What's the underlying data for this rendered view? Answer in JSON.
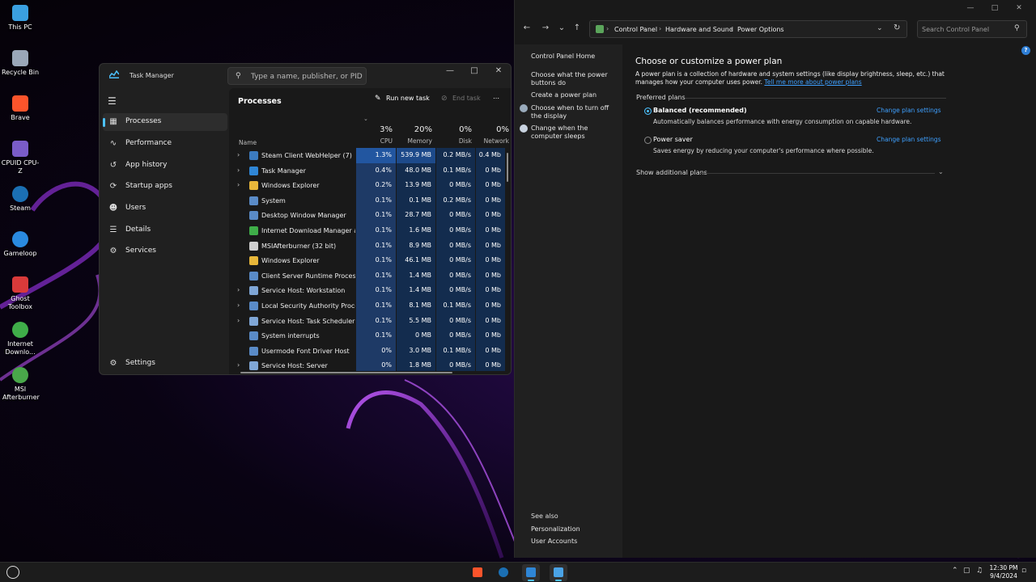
{
  "desktop": {
    "icons": [
      {
        "label": "This PC",
        "color": "#3aa0e0"
      },
      {
        "label": "Recycle Bin",
        "color": "#9aa8b8"
      },
      {
        "label": "Brave",
        "color": "#fb542b"
      },
      {
        "label": "CPUID CPU-Z",
        "color": "#7a5cc8"
      },
      {
        "label": "Steam",
        "color": "#1b6fb3"
      },
      {
        "label": "Gameloop",
        "color": "#2a8ae0"
      },
      {
        "label": "Ghost Toolbox",
        "color": "#d93a3a"
      },
      {
        "label": "Internet Downlo...",
        "color": "#3fae49"
      },
      {
        "label": "MSI Afterburner",
        "color": "#49a84a"
      }
    ]
  },
  "task_manager": {
    "title": "Task Manager",
    "search_placeholder": "Type a name, publisher, or PID...",
    "nav": [
      {
        "label": "Processes",
        "icon": "processes-icon",
        "active": true
      },
      {
        "label": "Performance",
        "icon": "performance-icon"
      },
      {
        "label": "App history",
        "icon": "history-icon"
      },
      {
        "label": "Startup apps",
        "icon": "startup-icon"
      },
      {
        "label": "Users",
        "icon": "users-icon"
      },
      {
        "label": "Details",
        "icon": "details-icon"
      },
      {
        "label": "Services",
        "icon": "services-icon"
      }
    ],
    "settings_label": "Settings",
    "toolbar": {
      "title": "Processes",
      "run_new_task": "Run new task",
      "end_task": "End task"
    },
    "columns": {
      "name": "Name",
      "cpu": {
        "pct": "3%",
        "label": "CPU"
      },
      "memory": {
        "pct": "20%",
        "label": "Memory"
      },
      "disk": {
        "pct": "0%",
        "label": "Disk"
      },
      "network": {
        "pct": "0%",
        "label": "Network"
      }
    },
    "processes": [
      {
        "name": "Steam Client WebHelper (7)",
        "cpu": "1.3%",
        "memory": "539.9 MB",
        "disk": "0.2 MB/s",
        "network": "0.4 Mb",
        "expandable": true,
        "icon_color": "#3c7bbf"
      },
      {
        "name": "Task Manager",
        "cpu": "0.4%",
        "memory": "48.0 MB",
        "disk": "0.1 MB/s",
        "network": "0 Mb",
        "expandable": true,
        "icon_color": "#2f86d6"
      },
      {
        "name": "Windows Explorer",
        "cpu": "0.2%",
        "memory": "13.9 MB",
        "disk": "0 MB/s",
        "network": "0 Mb",
        "expandable": true,
        "icon_color": "#e8b73a"
      },
      {
        "name": "System",
        "cpu": "0.1%",
        "memory": "0.1 MB",
        "disk": "0.2 MB/s",
        "network": "0 Mb",
        "expandable": false,
        "icon_color": "#5a8bc7"
      },
      {
        "name": "Desktop Window Manager",
        "cpu": "0.1%",
        "memory": "28.7 MB",
        "disk": "0 MB/s",
        "network": "0 Mb",
        "expandable": false,
        "icon_color": "#5a8bc7"
      },
      {
        "name": "Internet Download Manager a...",
        "cpu": "0.1%",
        "memory": "1.6 MB",
        "disk": "0 MB/s",
        "network": "0 Mb",
        "expandable": false,
        "icon_color": "#3fae49"
      },
      {
        "name": "MSIAfterburner (32 bit)",
        "cpu": "0.1%",
        "memory": "8.9 MB",
        "disk": "0 MB/s",
        "network": "0 Mb",
        "expandable": false,
        "icon_color": "#cfcfcf"
      },
      {
        "name": "Windows Explorer",
        "cpu": "0.1%",
        "memory": "46.1 MB",
        "disk": "0 MB/s",
        "network": "0 Mb",
        "expandable": false,
        "icon_color": "#e8b73a"
      },
      {
        "name": "Client Server Runtime Process",
        "cpu": "0.1%",
        "memory": "1.4 MB",
        "disk": "0 MB/s",
        "network": "0 Mb",
        "expandable": false,
        "icon_color": "#5a8bc7"
      },
      {
        "name": "Service Host: Workstation",
        "cpu": "0.1%",
        "memory": "1.4 MB",
        "disk": "0 MB/s",
        "network": "0 Mb",
        "expandable": true,
        "icon_color": "#7fa6d6"
      },
      {
        "name": "Local Security Authority Proce...",
        "cpu": "0.1%",
        "memory": "8.1 MB",
        "disk": "0.1 MB/s",
        "network": "0 Mb",
        "expandable": true,
        "icon_color": "#5a8bc7"
      },
      {
        "name": "Service Host: Task Scheduler",
        "cpu": "0.1%",
        "memory": "5.5 MB",
        "disk": "0 MB/s",
        "network": "0 Mb",
        "expandable": true,
        "icon_color": "#7fa6d6"
      },
      {
        "name": "System interrupts",
        "cpu": "0.1%",
        "memory": "0 MB",
        "disk": "0 MB/s",
        "network": "0 Mb",
        "expandable": false,
        "icon_color": "#5a8bc7"
      },
      {
        "name": "Usermode Font Driver Host",
        "cpu": "0%",
        "memory": "3.0 MB",
        "disk": "0.1 MB/s",
        "network": "0 Mb",
        "expandable": false,
        "icon_color": "#5a8bc7"
      },
      {
        "name": "Service Host: Server",
        "cpu": "0%",
        "memory": "1.8 MB",
        "disk": "0 MB/s",
        "network": "0 Mb",
        "expandable": true,
        "icon_color": "#7fa6d6"
      }
    ]
  },
  "control_panel": {
    "breadcrumbs": [
      "Control Panel",
      "Hardware and Sound",
      "Power Options"
    ],
    "search_placeholder": "Search Control Panel",
    "left_links": [
      {
        "label": "Control Panel Home"
      },
      {
        "label": "Choose what the power buttons do"
      },
      {
        "label": "Create a power plan"
      },
      {
        "label": "Choose when to turn off the display"
      },
      {
        "label": "Change when the computer sleeps"
      }
    ],
    "see_also": {
      "title": "See also",
      "links": [
        "Personalization",
        "User Accounts"
      ]
    },
    "heading": "Choose or customize a power plan",
    "description": "A power plan is a collection of hardware and system settings (like display brightness, sleep, etc.) that manages how your computer uses power.",
    "description_link": "Tell me more about power plans",
    "section": "Preferred plans",
    "plans": [
      {
        "name": "Balanced (recommended)",
        "description": "Automatically balances performance with energy consumption on capable hardware.",
        "change": "Change plan settings",
        "selected": true
      },
      {
        "name": "Power saver",
        "description": "Saves energy by reducing your computer's performance where possible.",
        "change": "Change plan settings",
        "selected": false
      }
    ],
    "show_additional": "Show additional plans"
  },
  "taskbar": {
    "apps": [
      {
        "name": "brave-taskbar",
        "color": "#fb542b"
      },
      {
        "name": "steam-taskbar",
        "color": "#1b6fb3"
      },
      {
        "name": "task-manager-taskbar",
        "color": "#2f86d6",
        "active": true
      },
      {
        "name": "control-panel-taskbar",
        "color": "#4aa3e6",
        "active": true
      }
    ],
    "time": "12:30 PM",
    "date": "9/4/2024"
  },
  "colors": {
    "accent": "#4cc2ff",
    "link": "#3ea0ff",
    "cpu_highlight": "#1e3a66",
    "cell_highlight": "#132c4e"
  }
}
